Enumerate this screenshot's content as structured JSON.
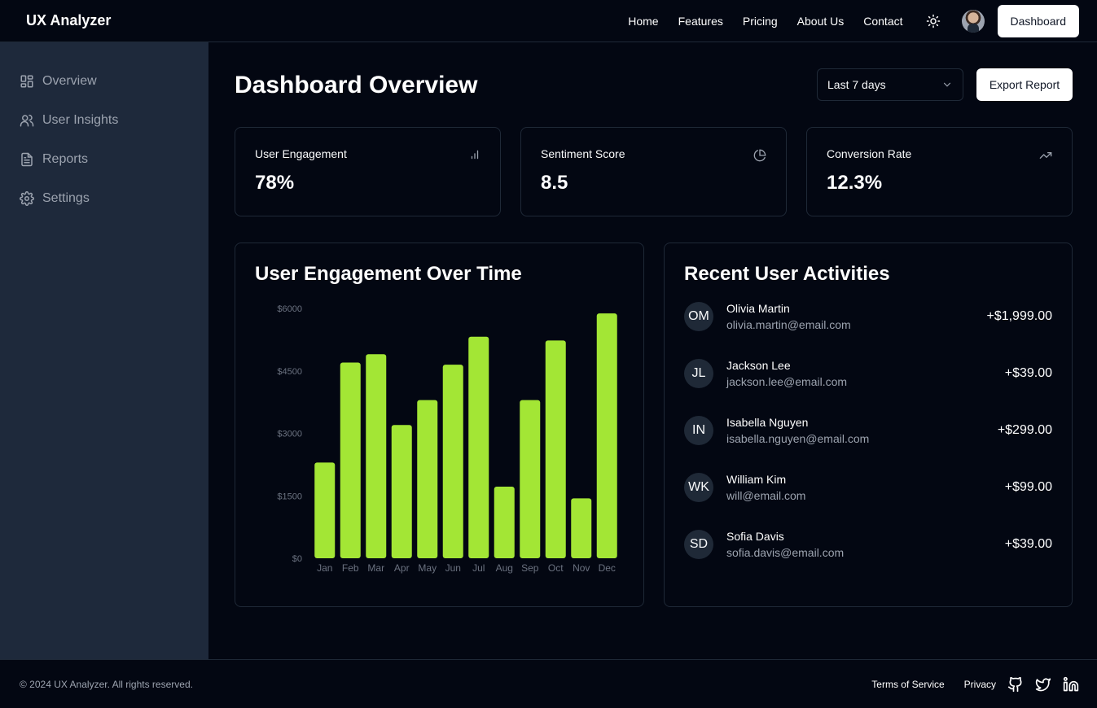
{
  "header": {
    "brand": "UX Analyzer",
    "nav": [
      "Home",
      "Features",
      "Pricing",
      "About Us",
      "Contact"
    ],
    "theme_icon": "sun-icon",
    "dashboard_label": "Dashboard"
  },
  "sidebar": {
    "items": [
      {
        "label": "Overview",
        "icon": "layout-grid-icon"
      },
      {
        "label": "User Insights",
        "icon": "users-icon"
      },
      {
        "label": "Reports",
        "icon": "file-text-icon"
      },
      {
        "label": "Settings",
        "icon": "gear-icon"
      }
    ]
  },
  "main": {
    "title": "Dashboard Overview",
    "range_select": "Last 7 days",
    "export_label": "Export Report",
    "stats": [
      {
        "label": "User Engagement",
        "value": "78%",
        "icon": "bar-chart-icon"
      },
      {
        "label": "Sentiment Score",
        "value": "8.5",
        "icon": "pie-chart-icon"
      },
      {
        "label": "Conversion Rate",
        "value": "12.3%",
        "icon": "trending-up-icon"
      }
    ],
    "chart_panel_title": "User Engagement Over Time",
    "activities_title": "Recent User Activities",
    "activities": [
      {
        "initials": "OM",
        "name": "Olivia Martin",
        "email": "olivia.martin@email.com",
        "amount": "+$1,999.00"
      },
      {
        "initials": "JL",
        "name": "Jackson Lee",
        "email": "jackson.lee@email.com",
        "amount": "+$39.00"
      },
      {
        "initials": "IN",
        "name": "Isabella Nguyen",
        "email": "isabella.nguyen@email.com",
        "amount": "+$299.00"
      },
      {
        "initials": "WK",
        "name": "William Kim",
        "email": "will@email.com",
        "amount": "+$99.00"
      },
      {
        "initials": "SD",
        "name": "Sofia Davis",
        "email": "sofia.davis@email.com",
        "amount": "+$39.00"
      }
    ]
  },
  "chart_data": {
    "type": "bar",
    "categories": [
      "Jan",
      "Feb",
      "Mar",
      "Apr",
      "May",
      "Jun",
      "Jul",
      "Aug",
      "Sep",
      "Oct",
      "Nov",
      "Dec"
    ],
    "values": [
      2300,
      4700,
      4900,
      3200,
      3800,
      4650,
      5320,
      1720,
      3800,
      5230,
      1440,
      5880
    ],
    "yticks": [
      "$0",
      "$1500",
      "$3000",
      "$4500",
      "$6000"
    ],
    "ylim": [
      0,
      6000
    ],
    "bar_color": "#a3e635"
  },
  "footer": {
    "copyright": "© 2024 UX Analyzer. All rights reserved.",
    "links": [
      "Terms of Service",
      "Privacy"
    ],
    "social_icons": [
      "github-icon",
      "twitter-icon",
      "linkedin-icon"
    ]
  }
}
